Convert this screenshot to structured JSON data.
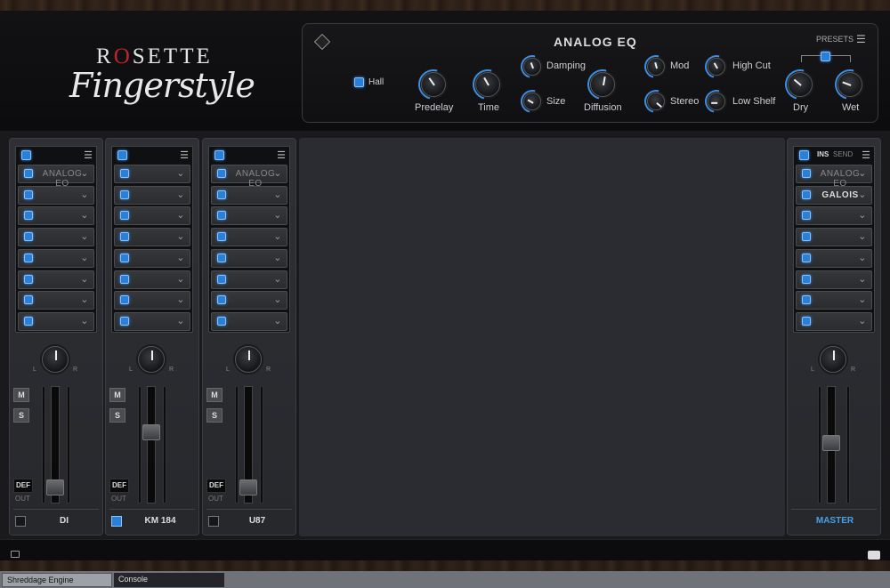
{
  "brand": {
    "rosette_r": "R",
    "rosette_o": "O",
    "rosette_rest": "SETTE",
    "fingerstyle": "Fingerstyle"
  },
  "fx": {
    "title": "ANALOG EQ",
    "presets": "PRESETS",
    "reverb_type": "Hall",
    "knobs": {
      "predelay": "Predelay",
      "time": "Time",
      "damping": "Damping",
      "size": "Size",
      "diffusion": "Diffusion",
      "mod": "Mod",
      "stereo": "Stereo",
      "high_cut": "High Cut",
      "low_shelf": "Low Shelf",
      "dry": "Dry",
      "wet": "Wet"
    }
  },
  "channels": [
    {
      "name": "DI",
      "slot1": "ANALOG EQ"
    },
    {
      "name": "KM 184",
      "slot1": ""
    },
    {
      "name": "U87",
      "slot1": "ANALOG EQ"
    }
  ],
  "master": {
    "name": "MASTER",
    "ins": "INS",
    "send": "SEND",
    "slot1": "ANALOG EQ",
    "slot2": "GALOIS"
  },
  "strip_labels": {
    "mute": "M",
    "solo": "S",
    "def": "DEF",
    "out": "OUT",
    "l": "L",
    "r": "R"
  },
  "fader_levels": {
    "DI": 0.08,
    "KM 184": 0.62,
    "U87": 0.08,
    "MASTER": 0.52
  },
  "taskbar": {
    "tab1": "Shreddage Engine",
    "tab2": "Console"
  },
  "colors": {
    "accent": "#2a7fd6",
    "brand_red": "#c0252c",
    "master_label": "#4aa0e6"
  }
}
